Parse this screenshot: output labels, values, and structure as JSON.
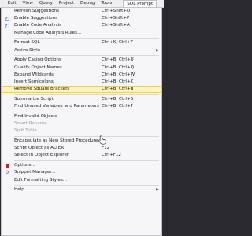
{
  "menubar": {
    "items": [
      {
        "label": "Edit"
      },
      {
        "label": "View"
      },
      {
        "label": "Query"
      },
      {
        "label": "Project"
      },
      {
        "label": "Debug"
      },
      {
        "label": "Tools"
      }
    ],
    "active": "SQL Prompt"
  },
  "menu": {
    "refresh": {
      "label": "Refresh Suggestions",
      "shortcut": "Ctrl+Shift+D"
    },
    "enable_suggestions": {
      "label": "Enable Suggestions",
      "shortcut": "Ctrl+Shift+P",
      "checked": "✓"
    },
    "enable_code_analysis": {
      "label": "Enable Code Analysis",
      "shortcut": "Ctrl+Shift+A",
      "checked": "✓"
    },
    "manage_rules": {
      "label": "Manage Code Analysis Rules..."
    },
    "format_sql": {
      "label": "Format SQL",
      "shortcut": "Ctrl+K, Ctrl+Y"
    },
    "active_style": {
      "label": "Active Style",
      "arrow": "▶"
    },
    "apply_casing": {
      "label": "Apply Casing Options",
      "shortcut": "Ctrl+B, Ctrl+U"
    },
    "qualify_names": {
      "label": "Qualify Object Names",
      "shortcut": "Ctrl+B, Ctrl+Q"
    },
    "expand_wildcards": {
      "label": "Expand Wildcards",
      "shortcut": "Ctrl+B, Ctrl+W"
    },
    "insert_semicolons": {
      "label": "Insert Semicolons",
      "shortcut": "Ctrl+B, Ctrl+C"
    },
    "remove_brackets": {
      "label": "Remove Square Brackets",
      "shortcut": "Ctrl+B, Ctrl+B"
    },
    "summarize_script": {
      "label": "Summarize Script",
      "shortcut": "Ctrl+B, Ctrl+S"
    },
    "find_unused": {
      "label": "Find Unused Variables and Parameters",
      "shortcut": "Ctrl+B, Ctrl+F"
    },
    "find_invalid": {
      "label": "Find Invalid Objects"
    },
    "smart_rename": {
      "label": "Smart Rename..."
    },
    "split_table": {
      "label": "Split Table..."
    },
    "encapsulate": {
      "label": "Encapsulate as New Stored Procedure..."
    },
    "script_alter": {
      "label": "Script Object as ALTER",
      "shortcut": "F12"
    },
    "select_explorer": {
      "label": "Select in Object Explorer",
      "shortcut": "Ctrl+F12"
    },
    "options": {
      "label": "Options..."
    },
    "snippet_manager": {
      "label": "Snippet Manager..."
    },
    "edit_formatting": {
      "label": "Edit Formatting Styles..."
    },
    "help": {
      "label": "Help",
      "arrow": "▶"
    }
  },
  "colors": {
    "highlight_bg": "#fbf3c4",
    "highlight_border": "#e5cf6e",
    "menu_bg": "#f6f6f8",
    "disabled_text": "#a0a0a6"
  },
  "icons": {
    "menubar_grip": "⁝",
    "options": "red-square-icon",
    "snippet_manager": "gear-icon"
  }
}
